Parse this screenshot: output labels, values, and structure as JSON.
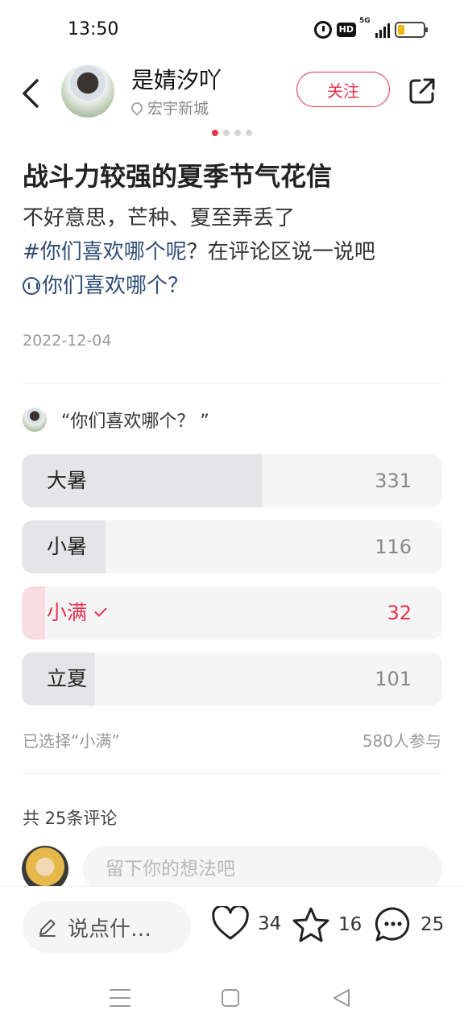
{
  "status_bar": {
    "time": "13:50",
    "hd": "HD",
    "network": "5G",
    "battery_level": 0.25
  },
  "header": {
    "author_name": "是婧汐吖",
    "location": "宏宇新城",
    "follow_label": "关注",
    "carousel": {
      "total": 4,
      "active": 1
    }
  },
  "post": {
    "title": "战斗力较强的夏季节气花信",
    "body_line1": "不好意思，芒种、夏至弄丢了",
    "tag_text": "#你们喜欢哪个呢",
    "body_line2_rest": "？在评论区说一说吧",
    "topic_text": "你们喜欢哪个？",
    "date": "2022-12-04"
  },
  "poll": {
    "question": "“你们喜欢哪个？ ”",
    "options": [
      {
        "label": "大暑",
        "count": "331",
        "share": 0.5707,
        "selected": false
      },
      {
        "label": "小暑",
        "count": "116",
        "share": 0.2,
        "selected": false
      },
      {
        "label": "小满",
        "count": "32",
        "share": 0.0552,
        "selected": true
      },
      {
        "label": "立夏",
        "count": "101",
        "share": 0.1741,
        "selected": false
      }
    ],
    "selected_text": "已选择“小满”",
    "participants": "580人参与"
  },
  "comments": {
    "count_text": "共 25条评论",
    "input_placeholder": "留下你的想法吧"
  },
  "bottom_bar": {
    "say_label": "说点什…",
    "likes": "34",
    "favorites": "16",
    "comments": "25"
  },
  "colors": {
    "accent": "#e8324c",
    "topic": "#2f4d76"
  }
}
